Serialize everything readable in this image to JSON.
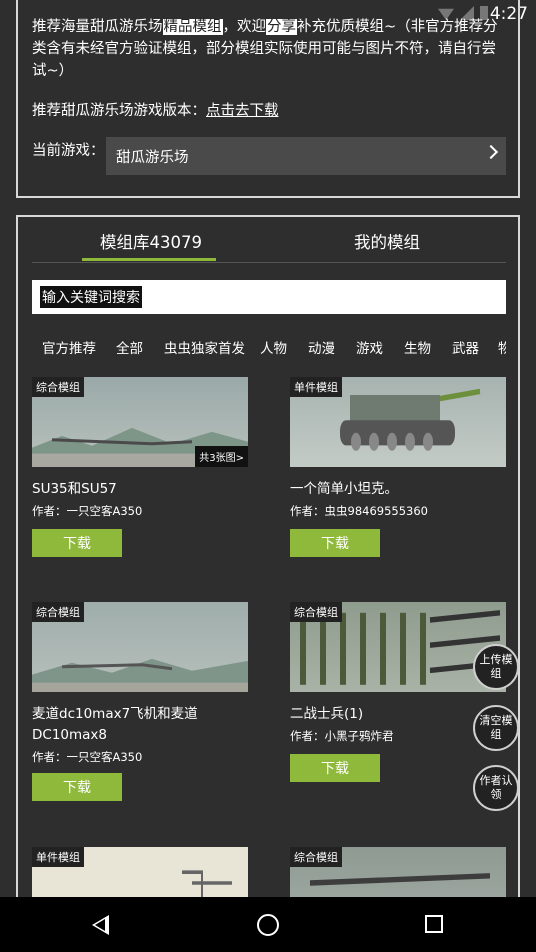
{
  "status_bar": {
    "time": "4:27"
  },
  "info": {
    "text_before": "推荐海量甜瓜游乐场",
    "text_highlight_1": "精品模组",
    "text_middle_1": "，欢迎",
    "text_highlight_2": "分享",
    "text_after": "补充优质模组~（非官方推荐分类含有未经官方验证模组，部分模组实际使用可能与图片不符，请自行尝试~）",
    "version_label": "推荐甜瓜游乐场游戏版本：",
    "version_link": "点击去下载",
    "current_game_label": "当前游戏：",
    "current_game_value": "甜瓜游乐场"
  },
  "tabs": [
    {
      "label": "模组库43079",
      "active": true
    },
    {
      "label": "我的模组",
      "active": false
    }
  ],
  "search": {
    "placeholder": "输入关键词搜索"
  },
  "categories": [
    "官方推荐",
    "全部",
    "虫虫独家首发",
    "人物",
    "动漫",
    "游戏",
    "生物",
    "武器",
    "物"
  ],
  "cards": [
    {
      "tag": "综合模组",
      "image_count": "共3张图>",
      "title": "SU35和SU57",
      "author_label": "作者：",
      "author": "一只空客A350",
      "download": "下载"
    },
    {
      "tag": "单件模组",
      "image_count": "",
      "title": "一个简单小坦克。",
      "author_label": "作者：",
      "author": "虫虫98469555360",
      "download": "下载"
    },
    {
      "tag": "综合模组",
      "image_count": "",
      "title": "麦道dc10max7飞机和麦道DC10max8",
      "author_label": "作者：",
      "author": "一只空客A350",
      "download": "下载"
    },
    {
      "tag": "综合模组",
      "image_count": "",
      "title": "二战士兵(1)",
      "author_label": "作者：",
      "author": "小黑子鸦炸君",
      "download": "下载"
    },
    {
      "tag": "单件模组",
      "image_count": "",
      "title": "",
      "author_label": "",
      "author": "",
      "download": ""
    },
    {
      "tag": "综合模组",
      "image_count": "",
      "title": "",
      "author_label": "",
      "author": "",
      "download": ""
    }
  ],
  "floating_buttons": [
    {
      "label": "上传模组"
    },
    {
      "label": "清空模组"
    },
    {
      "label": "作者认领"
    }
  ],
  "colors": {
    "accent": "#8fb93a",
    "background": "#2e2e2e",
    "panel_border": "#d8d8d8"
  }
}
